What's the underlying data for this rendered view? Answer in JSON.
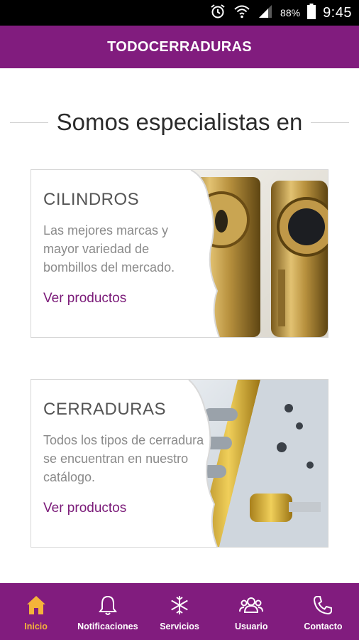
{
  "status_bar": {
    "battery": "88%",
    "time": "9:45",
    "icons": [
      "alarm-icon",
      "wifi-icon",
      "signal-icon",
      "battery-icon"
    ]
  },
  "header": {
    "title": "TODOCERRADURAS"
  },
  "section": {
    "heading": "Somos especialistas en"
  },
  "cards": [
    {
      "title": "CILINDROS",
      "description": "Las mejores marcas y mayor variedad de bombillos del mercado.",
      "link": "Ver productos",
      "image": "cylinder-locks-photo"
    },
    {
      "title": "CERRADURAS",
      "description": "Todos los tipos de cerradura se encuentran en nuestro catálogo.",
      "link": "Ver productos",
      "image": "door-lock-photo"
    }
  ],
  "bottom_nav": {
    "items": [
      {
        "label": "Inicio",
        "icon": "home-icon",
        "active": true
      },
      {
        "label": "Notificaciones",
        "icon": "bell-icon",
        "active": false
      },
      {
        "label": "Servicios",
        "icon": "snowflake-icon",
        "active": false
      },
      {
        "label": "Usuario",
        "icon": "users-icon",
        "active": false
      },
      {
        "label": "Contacto",
        "icon": "phone-icon",
        "active": false
      }
    ]
  },
  "colors": {
    "brand": "#811c7e",
    "active": "#f4b33a",
    "link": "#7a1a78"
  }
}
